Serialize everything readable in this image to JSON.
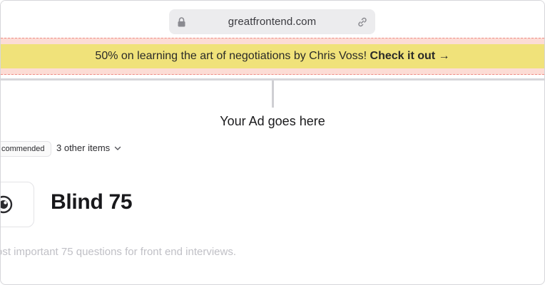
{
  "browser": {
    "url": "greatfrontend.com"
  },
  "banner": {
    "message": "50% on learning the art of negotiations by Chris Voss!",
    "cta": "Check it out →",
    "bg_color": "#f0e27a",
    "zone_color": "#fcdcd5"
  },
  "ad": {
    "caption": "Your Ad goes here"
  },
  "filters": {
    "tag": "commended",
    "dropdown_label": "3 other items"
  },
  "content": {
    "title": "Blind 75",
    "description": "ost important 75 questions for front end interviews."
  },
  "icons": {
    "lock": "lock-icon",
    "link": "link-icon",
    "chevron": "chevron-down-icon",
    "logo": "eye-icon"
  }
}
